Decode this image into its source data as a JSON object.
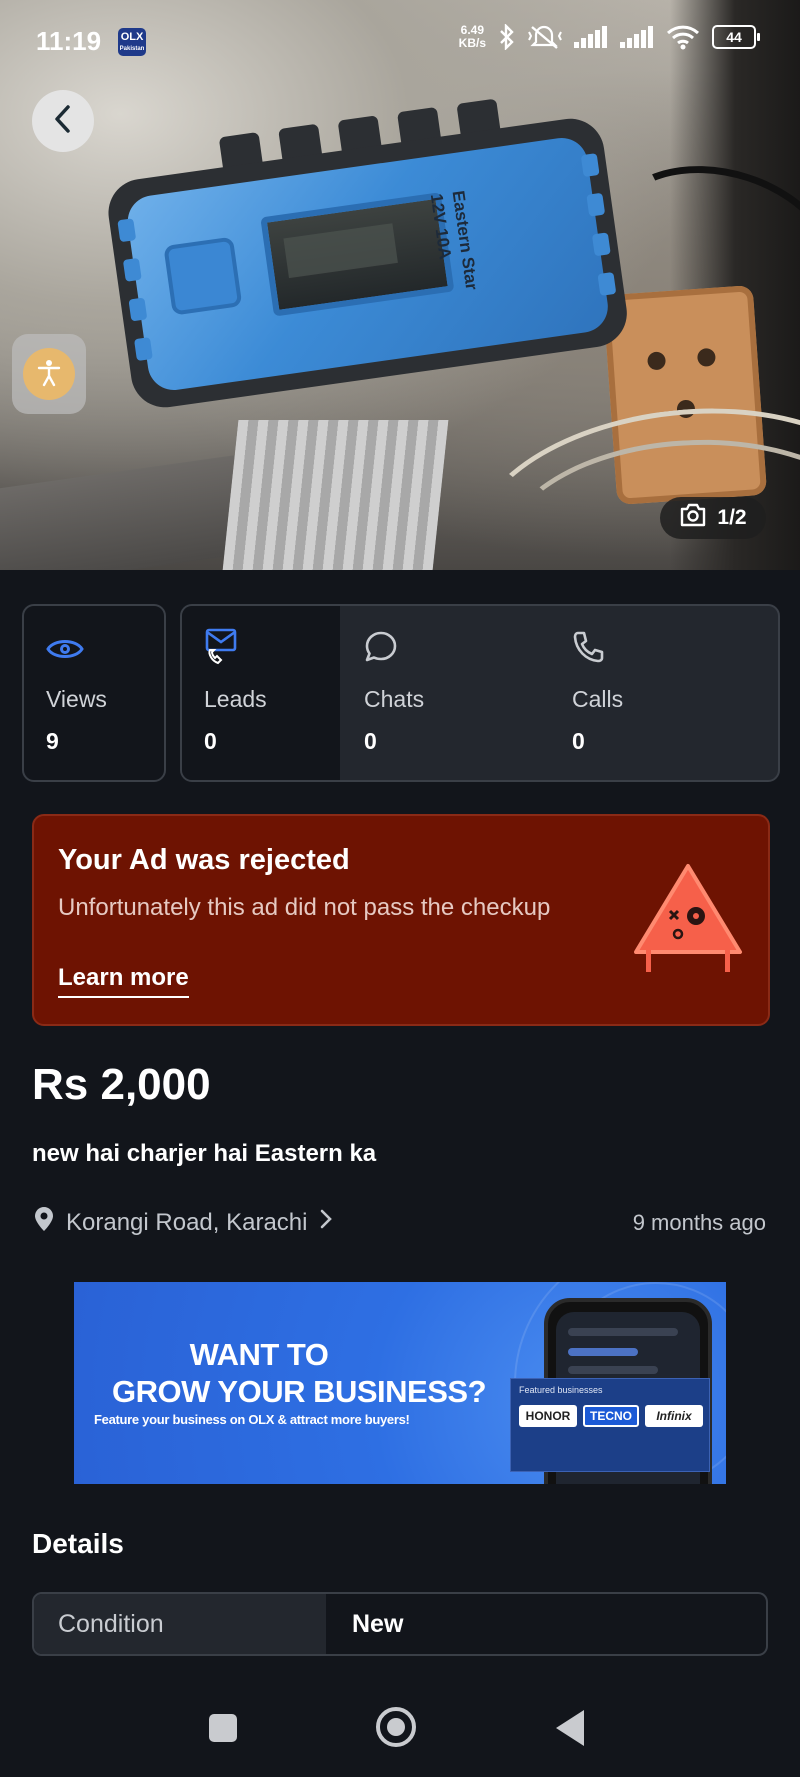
{
  "status_bar": {
    "time": "11:19",
    "app_badge": "OLX",
    "app_badge_sub": "Pakistan",
    "net_speed_value": "6.49",
    "net_speed_unit": "KB/s",
    "battery": "44"
  },
  "gallery": {
    "counter": "1/2",
    "product_brand_text": "Eastern Star",
    "product_rating_text": "12V 10A",
    "icons": [
      "chevron-left-icon",
      "accessibility-icon",
      "camera-icon"
    ]
  },
  "stats": [
    {
      "label": "Views",
      "value": "9",
      "icon": "eye-icon"
    },
    {
      "label": "Leads",
      "value": "0",
      "icon": "mail-phone-icon"
    },
    {
      "label": "Chats",
      "value": "0",
      "icon": "chat-icon"
    },
    {
      "label": "Calls",
      "value": "0",
      "icon": "phone-icon"
    }
  ],
  "rejection": {
    "title": "Your Ad was rejected",
    "message": "Unfortunately this ad did not pass the checkup",
    "link": "Learn more",
    "bg_color": "#6e1302",
    "icon_color": "#f6604a"
  },
  "listing": {
    "price": "Rs 2,000",
    "title": "new hai charjer hai Eastern ka",
    "location": "Korangi Road, Karachi",
    "posted": "9 months ago"
  },
  "promo": {
    "line1": "WANT TO",
    "line2": "GROW YOUR BUSINESS?",
    "sub": "Feature your business on OLX & attract more buyers!",
    "featured_label": "Featured businesses",
    "brands": [
      "HONOR",
      "TECNO",
      "Infinix"
    ],
    "bg_color": "#2e6fe3"
  },
  "details": {
    "heading": "Details",
    "rows": [
      {
        "key": "Condition",
        "value": "New"
      }
    ]
  },
  "theme": {
    "background": "#12151b",
    "card": "#23272e",
    "border": "#3a3f47",
    "accent_blue": "#3f7bf0"
  }
}
